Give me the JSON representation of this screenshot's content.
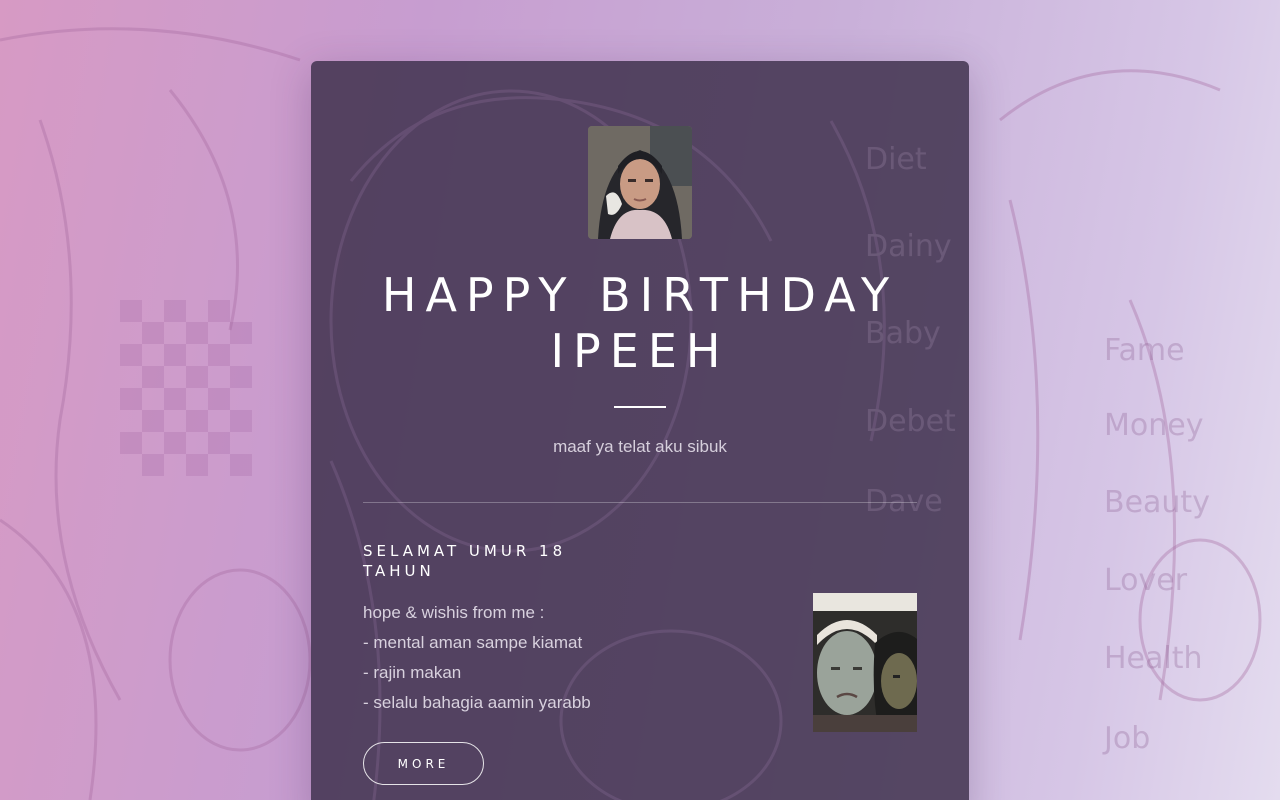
{
  "card": {
    "title_line1": "HAPPY BIRTHDAY",
    "title_line2": "IPEEH",
    "subtitle": "maaf ya telat aku sibuk",
    "section_heading": "SELAMAT UMUR 18 TAHUN",
    "wishes": [
      "hope & wishis from me :",
      "- mental aman sampe kiamat",
      "- rajin makan",
      "- selalu bahagia aamin yarabb"
    ],
    "more_label": "MORE"
  },
  "background_words": [
    "Fame",
    "Money",
    "Beauty",
    "Lover",
    "Health",
    "Job",
    "Diet",
    "Dainy",
    "Baby",
    "Debet",
    "Dave"
  ],
  "colors": {
    "card_bg": "#40324e",
    "background_left": "#d79ac4",
    "background_right": "#e4dcef",
    "text_primary": "#ffffff",
    "text_muted": "#d8d1de"
  }
}
